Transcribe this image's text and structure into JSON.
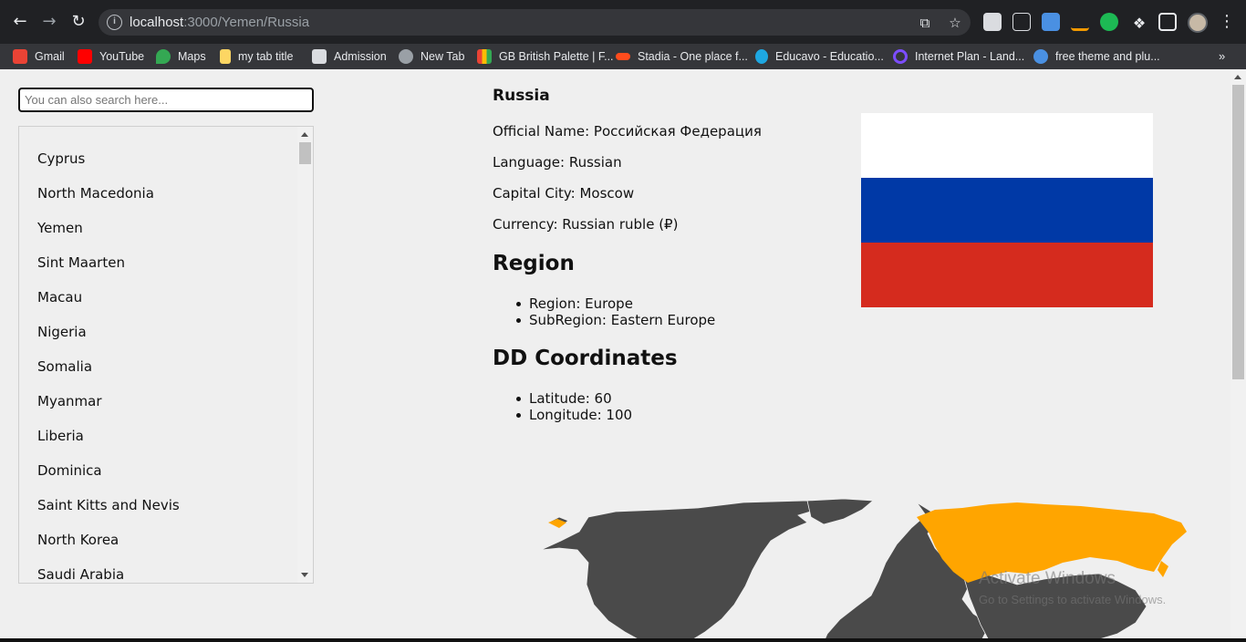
{
  "browser": {
    "url_host": "localhost",
    "url_path": ":3000/Yemen/Russia",
    "bookmarks": [
      {
        "label": "Gmail",
        "icon": "gmail-icon",
        "color": "#ea4335"
      },
      {
        "label": "YouTube",
        "icon": "youtube-icon",
        "color": "#ff0000"
      },
      {
        "label": "Maps",
        "icon": "maps-icon",
        "color": "#34a853"
      },
      {
        "label": "my tab title",
        "icon": "bookmark-page-icon",
        "color": "#fdd663"
      },
      {
        "label": "Admission",
        "icon": "admission-icon",
        "color": "#dadce0"
      },
      {
        "label": "New Tab",
        "icon": "globe-icon",
        "color": "#9aa0a6"
      },
      {
        "label": "GB British Palette | F...",
        "icon": "palette-icon",
        "color": "#fbbc04"
      },
      {
        "label": "Stadia - One place f...",
        "icon": "stadia-icon",
        "color": "#ff4c1d"
      },
      {
        "label": "Educavo - Educatio...",
        "icon": "educavo-icon",
        "color": "#1ea7e1"
      },
      {
        "label": "Internet Plan - Land...",
        "icon": "internet-plan-icon",
        "color": "#7c4dff"
      },
      {
        "label": "free theme and plu...",
        "icon": "theme-icon",
        "color": "#4a90e2"
      }
    ],
    "more_bookmarks": "»"
  },
  "search": {
    "placeholder": "You can also search here..."
  },
  "countries": [
    "Cyprus",
    "North Macedonia",
    "Yemen",
    "Sint Maarten",
    "Macau",
    "Nigeria",
    "Somalia",
    "Myanmar",
    "Liberia",
    "Dominica",
    "Saint Kitts and Nevis",
    "North Korea",
    "Saudi Arabia"
  ],
  "country": {
    "name": "Russia",
    "official_name": "Official Name: Российская Федерация",
    "language": "Language: Russian",
    "capital": "Capital City: Moscow",
    "currency": "Currency: Russian ruble (₽)"
  },
  "region_section": {
    "heading": "Region",
    "region": "Region: Europe",
    "subregion": "SubRegion: Eastern Europe"
  },
  "coords_section": {
    "heading": "DD Coordinates",
    "latitude": "Latitude: 60",
    "longitude": "Longitude: 100"
  },
  "flag": {
    "colors": [
      "#ffffff",
      "#0039a6",
      "#d52b1e"
    ]
  },
  "map": {
    "highlight_color": "#ffa500",
    "land_color": "#4a4a4a"
  },
  "watermark": {
    "title": "Activate Windows",
    "subtitle": "Go to Settings to activate Windows."
  }
}
